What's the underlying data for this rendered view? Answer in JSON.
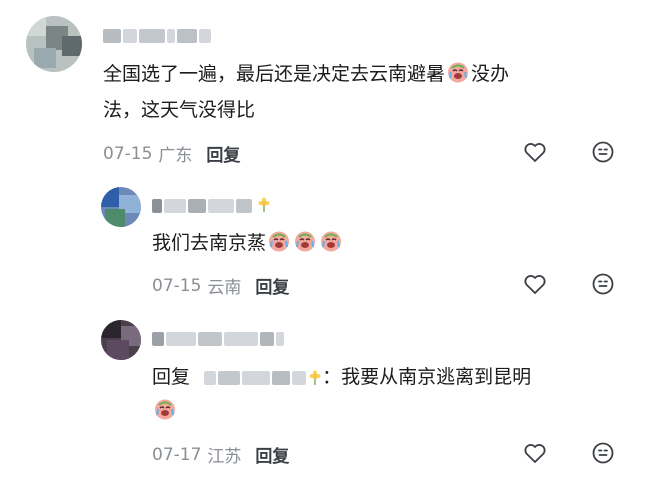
{
  "comments": [
    {
      "text_line1": "全国选了一遍，最后还是决定去云南避暑",
      "text_line1_tail": "没办",
      "text_line2": "法，这天气没得比",
      "date": "07-15",
      "location": "广东",
      "reply_label": "回复"
    },
    {
      "text": "我们去南京蒸",
      "date": "07-15",
      "location": "云南",
      "reply_label": "回复"
    },
    {
      "reply_prefix": "回复",
      "text": "：我要从南京逃离到昆明",
      "date": "07-17",
      "location": "江苏",
      "reply_label": "回复"
    }
  ],
  "icons": {
    "like": "heart-outline-icon",
    "react": "smiley-icon",
    "emoji": "crying-laughing-emoji"
  },
  "colors": {
    "meta": "#8a8f96",
    "reply": "#3b3f45",
    "text": "#1c1c1c"
  }
}
